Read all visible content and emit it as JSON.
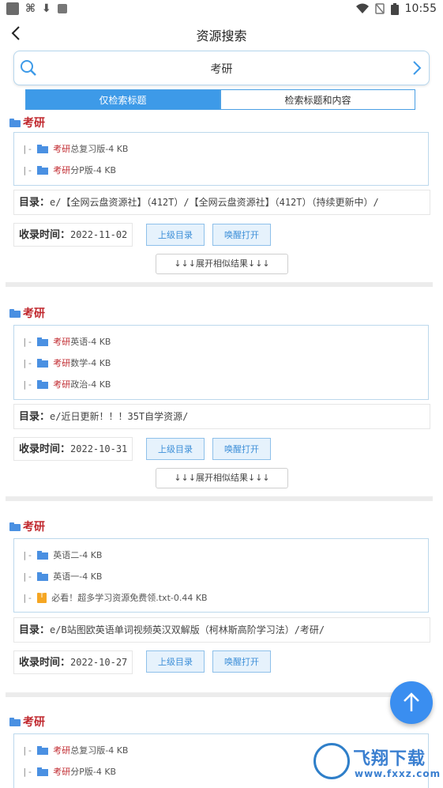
{
  "status_bar": {
    "time": "10:55"
  },
  "app_bar": {
    "title": "资源搜索"
  },
  "search": {
    "keyword": "考研"
  },
  "modes": [
    {
      "label": "仅检索标题",
      "active": true
    },
    {
      "label": "检索标题和内容",
      "active": false
    }
  ],
  "labels": {
    "dir": "目录：",
    "date": "收录时间：",
    "parent_button": "上级目录",
    "open_button": "唤醒打开",
    "expand_similar": "↓↓↓展开相似结果↓↓↓"
  },
  "results": [
    {
      "title": "考研",
      "files": [
        {
          "prefix": "|-",
          "type": "folder",
          "keyword": "考研",
          "rest": "总复习版-4 KB"
        },
        {
          "prefix": "|-",
          "type": "folder",
          "keyword": "考研",
          "rest": "分P版-4 KB"
        }
      ],
      "dir": "e/【全网云盘资源社】（412T）/【全网云盘资源社】（412T）（持续更新中）/",
      "date": "2022-11-02"
    },
    {
      "title": "考研",
      "files": [
        {
          "prefix": "|-",
          "type": "folder",
          "keyword": "考研",
          "rest": "英语-4 KB"
        },
        {
          "prefix": "|-",
          "type": "folder",
          "keyword": "考研",
          "rest": "数学-4 KB"
        },
        {
          "prefix": "|-",
          "type": "folder",
          "keyword": "考研",
          "rest": "政治-4 KB"
        }
      ],
      "dir": "e/近日更新！！！35T自学资源/",
      "date": "2022-10-31"
    },
    {
      "title": "考研",
      "files": [
        {
          "prefix": "|-",
          "type": "folder",
          "keyword": "",
          "rest": "英语二-4 KB"
        },
        {
          "prefix": "|-",
          "type": "folder",
          "keyword": "",
          "rest": "英语一-4 KB"
        },
        {
          "prefix": "|-",
          "type": "txt",
          "keyword": "",
          "rest": "必看！超多学习资源免费领.txt-0.44 KB"
        }
      ],
      "dir": "e/B站图欧英语单词视频英汉双解版（柯林斯高阶学习法）/考研/",
      "date": "2022-10-27"
    },
    {
      "title": "考研",
      "files": [
        {
          "prefix": "|-",
          "type": "folder",
          "keyword": "考研",
          "rest": "总复习版-4 KB"
        },
        {
          "prefix": "|-",
          "type": "folder",
          "keyword": "考研",
          "rest": "分P版-4 KB"
        }
      ]
    }
  ],
  "watermark": {
    "name": "飞翔下载",
    "url": "www.fxxz.com"
  },
  "colors": {
    "accent": "#3d9ae8",
    "keyword": "#c0272d",
    "fab": "#3a8ef0"
  }
}
